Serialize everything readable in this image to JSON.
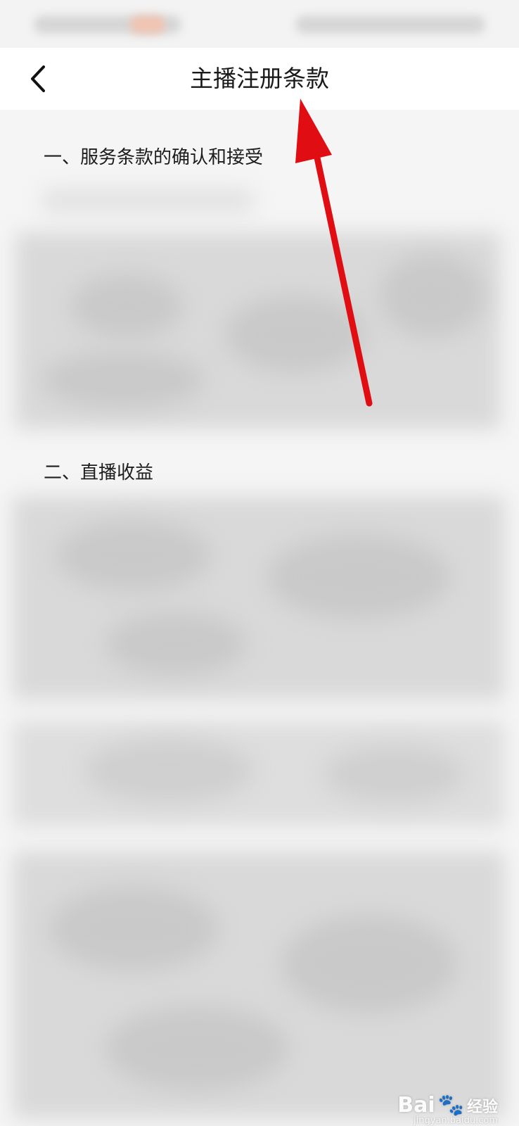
{
  "header": {
    "title": "主播注册条款",
    "back_icon": "chevron-left-icon"
  },
  "sections": [
    {
      "title": "一、服务条款的确认和接受"
    },
    {
      "title": "二、直播收益"
    }
  ],
  "annotation": {
    "arrow_color": "#e00d12"
  },
  "watermark": {
    "brand": "Bai",
    "brand_suffix": "经验",
    "url": "jingyan.baidu.com"
  },
  "colors": {
    "page_bg": "#f5f5f5",
    "nav_bg": "#ffffff",
    "title_text": "#1a1a1a"
  }
}
